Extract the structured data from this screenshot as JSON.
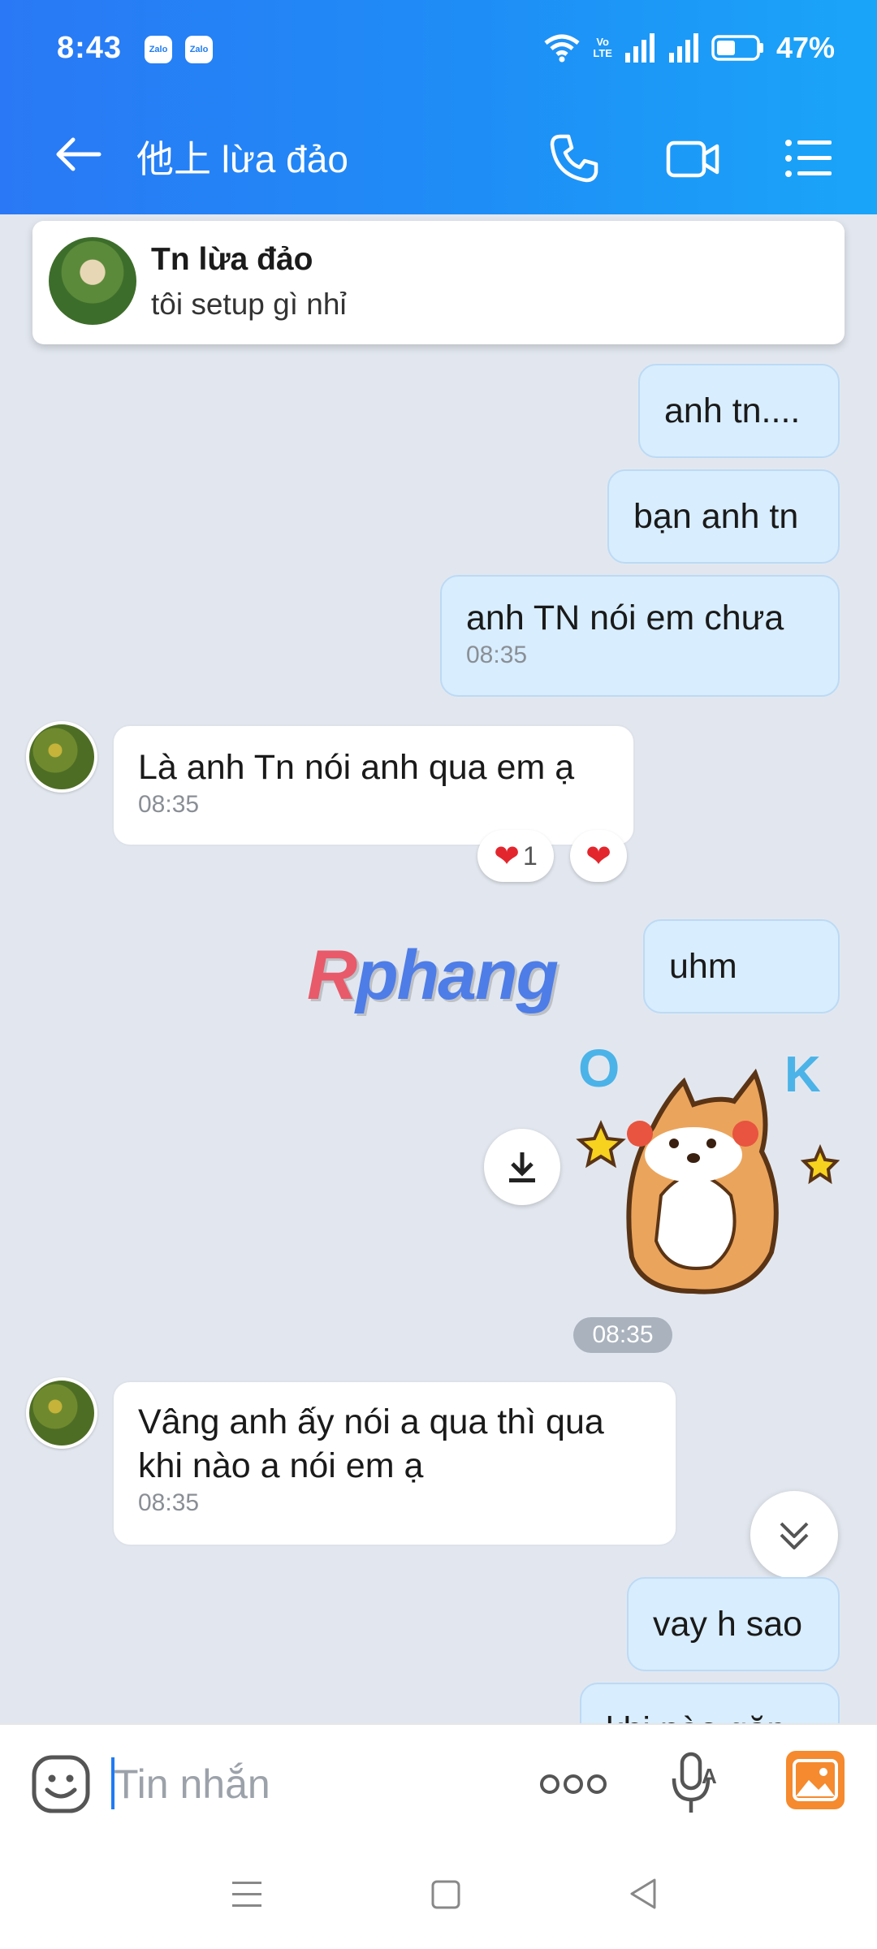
{
  "status_bar": {
    "time": "8:43",
    "notif_icons": [
      "Zalo",
      "Zalo"
    ],
    "volte": "Vo\nLTE",
    "battery": "47%"
  },
  "header": {
    "title": "他上 lừa đảo",
    "icons": [
      "back-arrow-icon",
      "phone-icon",
      "video-call-icon",
      "menu-list-icon"
    ]
  },
  "pinned": {
    "name": "Tn lừa đảo",
    "message": "tôi setup gì nhỉ"
  },
  "messages": {
    "m1": "anh tn....",
    "m2": "bạn anh tn",
    "m3": "anh TN nói em chưa",
    "m3_time": "08:35",
    "m4": "Là anh Tn nói anh qua em ạ",
    "m4_time": "08:35",
    "m4_react_count": "1",
    "m5": "uhm",
    "sticker_time": "08:35",
    "m6_line1": "Vâng anh ấy nói a qua thì qua",
    "m6_line2": "khi nào a nói em ạ",
    "m6_time": "08:35",
    "m7": "vay h sao",
    "m8_partial": "khi nào gặp"
  },
  "sticker": {
    "letters": [
      "O",
      "K"
    ]
  },
  "watermark": {
    "text_part1": "R",
    "text_part2": "phang"
  },
  "input": {
    "placeholder": "Tin nhắn"
  },
  "colors": {
    "header_start": "#2a78f5",
    "header_end": "#1aa5f9",
    "my_bubble": "#d8edfd",
    "their_bubble": "#ffffff",
    "background": "#e2e7ef",
    "heart": "#e3262d"
  }
}
